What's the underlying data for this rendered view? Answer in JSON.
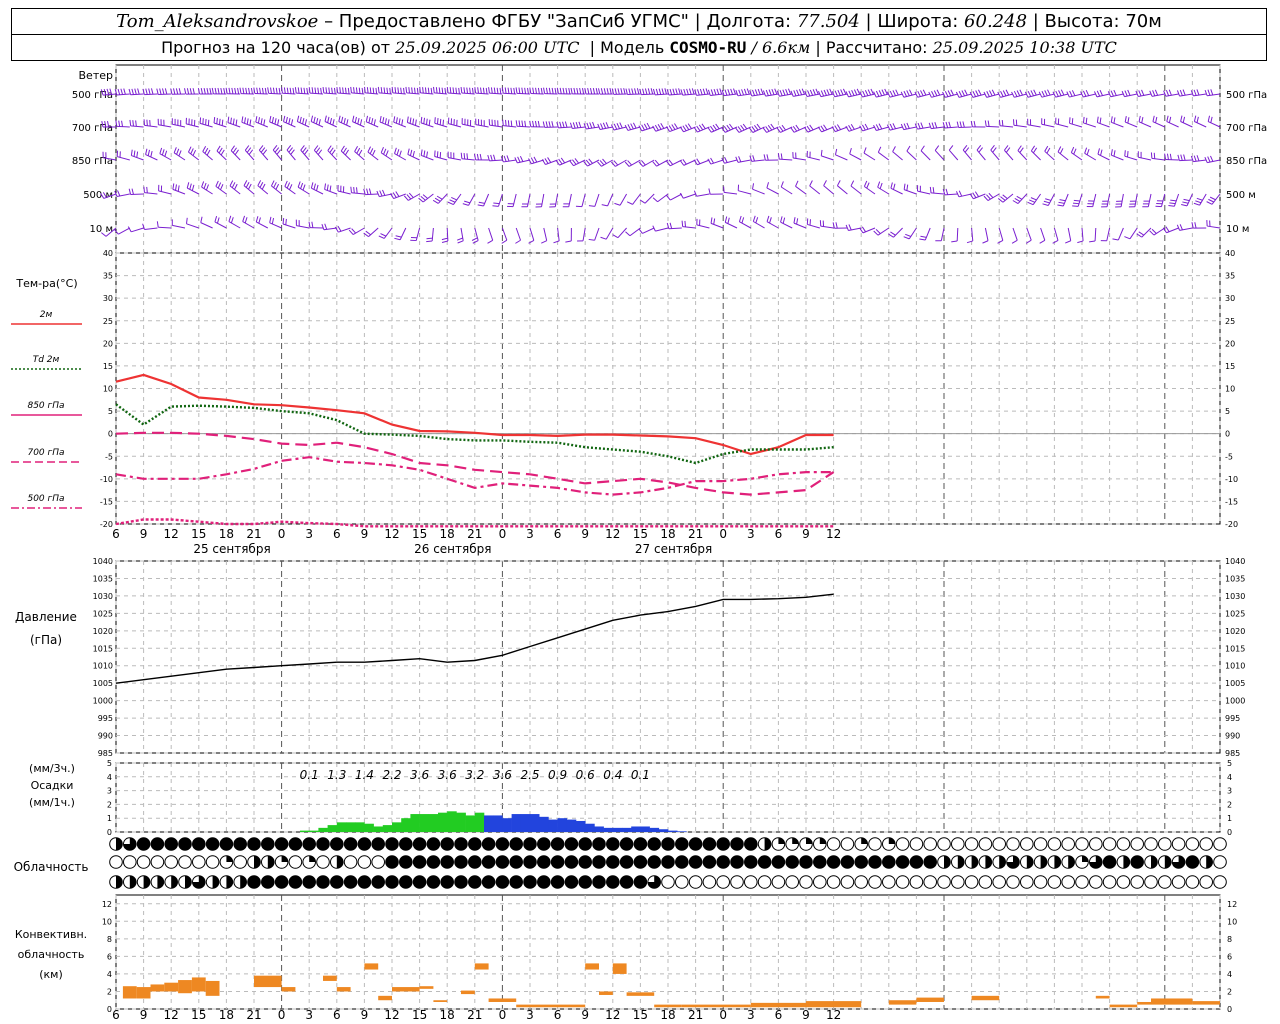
{
  "header": {
    "station": "Tom_Aleksandrovskoe",
    "provider": "– Предоставлено ФГБУ \"ЗапСиб УГМС\"",
    "lon_label": "Долгота:",
    "lon_value": "77.504",
    "lat_label": "Широта:",
    "lat_value": "60.248",
    "alt_label": "Высота:",
    "alt_value": "70м",
    "forecast_label": "Прогноз на 120 часа(ов) от",
    "forecast_start": "25.09.2025 06:00 UTC",
    "model_label": "Модель",
    "model_name": "COSMO-RU",
    "model_res": "/ 6.6км",
    "calc_label": "Рассчитано:",
    "calc_time": "25.09.2025 10:38 UTC"
  },
  "colors": {
    "wind": "#7a1fd0",
    "t2m": "#ee3333",
    "td2m": "#116611",
    "t850": "#e0207a",
    "t700": "#e0207a",
    "t500": "#e0207a",
    "pressure": "#000000",
    "precip_liquid": "#22cc22",
    "precip_snow": "#2244dd",
    "convective": "#ee8822"
  },
  "time_axis": {
    "hour_ticks": [
      "6",
      "9",
      "12",
      "15",
      "18",
      "21",
      "0",
      "3",
      "6",
      "9",
      "12",
      "15",
      "18",
      "21",
      "0",
      "3",
      "6",
      "9",
      "12",
      "15",
      "18",
      "21",
      "0",
      "3",
      "6",
      "9",
      "12"
    ],
    "date_labels": [
      "25 сентября",
      "26 сентября",
      "27 сентября"
    ]
  },
  "wind_panel": {
    "title": "Ветер",
    "levels": [
      "500 гПа",
      "700 гПа",
      "850 гПа",
      "500 м",
      "10 м"
    ]
  },
  "temp_panel": {
    "title": "Тем-ра(°С)",
    "legend": [
      {
        "label": "2м",
        "style": "solid"
      },
      {
        "label": "Td  2м",
        "style": "dotted"
      },
      {
        "label": "850 гПа",
        "style": "solid"
      },
      {
        "label": "700 гПа",
        "style": "dash"
      },
      {
        "label": "500 гПа",
        "style": "dashdot"
      }
    ],
    "ticks": [
      "40",
      "35",
      "30",
      "25",
      "20",
      "15",
      "10",
      "5",
      "0",
      "-5",
      "-10",
      "-15",
      "-20"
    ]
  },
  "pressure_panel": {
    "title": "Давление",
    "unit": "(гПа)",
    "ticks": [
      "1040",
      "1035",
      "1030",
      "1025",
      "1020",
      "1015",
      "1010",
      "1005",
      "1000",
      "995",
      "990",
      "985"
    ]
  },
  "precip_panel": {
    "unit3h": "(мм/3ч.)",
    "title": "Осадки",
    "unit1h": "(мм/1ч.)",
    "ticks": [
      "5",
      "4",
      "3",
      "2",
      "1",
      "0"
    ],
    "totals": [
      "0.1",
      "1.3",
      "1.4",
      "2.2",
      "3.6",
      "3.6",
      "3.2",
      "3.6",
      "2.5",
      "0.9",
      "0.6",
      "0.4",
      "0.1"
    ]
  },
  "cloud_panel": {
    "title": "Облачность"
  },
  "conv_panel": {
    "title_line1": "Конвективн.",
    "title_line2": "облачность",
    "unit": "(км)",
    "ticks": [
      "12",
      "10",
      "8",
      "6",
      "4",
      "2",
      "0"
    ]
  },
  "chart_data": {
    "type": "line",
    "hours": [
      0,
      3,
      6,
      9,
      12,
      15,
      18,
      21,
      24,
      27,
      30,
      33,
      36,
      39,
      42,
      45,
      48,
      51,
      54,
      57,
      60,
      63,
      66,
      69,
      72,
      75,
      78
    ],
    "series": [
      {
        "name": "2м",
        "unit": "°C",
        "values": [
          11.5,
          13,
          11,
          8,
          7.5,
          6.5,
          6.3,
          5.8,
          5.2,
          4.5,
          2,
          0.6,
          0.5,
          0.2,
          -0.3,
          -0.3,
          -0.5,
          -0.2,
          -0.2,
          -0.4,
          -0.6,
          -1,
          -2.5,
          -4.5,
          -3,
          -0.3,
          -0.3
        ]
      },
      {
        "name": "Td  2м",
        "unit": "°C",
        "values": [
          6.5,
          2,
          6,
          6.2,
          6,
          5.7,
          5,
          4.5,
          3,
          0,
          -0.2,
          -0.5,
          -1.2,
          -1.5,
          -1.5,
          -1.8,
          -2,
          -3,
          -3.5,
          -4,
          -5,
          -6.5,
          -4.5,
          -3.5,
          -3.5,
          -3.5,
          -3
        ]
      },
      {
        "name": "850 гПа",
        "unit": "°C",
        "values": [
          0,
          0.2,
          0.2,
          0,
          -0.5,
          -1.2,
          -2.2,
          -2.5,
          -2,
          -3,
          -4.5,
          -6.5,
          -7,
          -8,
          -8.5,
          -9,
          -10,
          -11,
          -10.5,
          -10,
          -10.8,
          -12,
          -13,
          -13.5,
          -13,
          -12.5,
          -8.5
        ]
      },
      {
        "name": "700 гПа",
        "unit": "°C",
        "values": [
          -9,
          -10,
          -10,
          -10,
          -9,
          -7.8,
          -6,
          -5.2,
          -6.2,
          -6.5,
          -7,
          -8,
          -10,
          -12,
          -11,
          -11.5,
          -12,
          -13,
          -13.5,
          -13,
          -12,
          -10.5,
          -10.5,
          -10,
          -9,
          -8.5,
          -8.5
        ]
      },
      {
        "name": "500 гПа",
        "unit": "°C",
        "values": [
          -20,
          -19,
          -19,
          -19.5,
          -20,
          -20,
          -19.5,
          -19.8,
          -20,
          -20.5,
          -21,
          -21,
          -21,
          -21,
          -21,
          -21,
          -21,
          -21,
          -21,
          -21,
          -21,
          -21,
          -21,
          -21,
          -21,
          -21,
          -21
        ]
      },
      {
        "name": "Давление",
        "unit": "гПа",
        "values": [
          1005,
          1006,
          1007,
          1008,
          1009,
          1009.5,
          1010,
          1010.5,
          1011,
          1011,
          1011.5,
          1012,
          1011,
          1011.5,
          1013,
          1015.5,
          1018,
          1020.5,
          1023,
          1024.5,
          1025.5,
          1027,
          1029,
          1029,
          1029.2,
          1029.6,
          1030.5
        ]
      }
    ],
    "precip_hourly_liquid": [
      0,
      0,
      0,
      0,
      0,
      0,
      0,
      0,
      0,
      0,
      0,
      0,
      0,
      0,
      0,
      0,
      0,
      0,
      0,
      0,
      0.1,
      0.1,
      0.3,
      0.5,
      0.7,
      0.7,
      0.7,
      0.6,
      0.4,
      0.5,
      0.7,
      1.0,
      1.3,
      1.3,
      1.3,
      1.4,
      1.5,
      1.4,
      1.2,
      1.4
    ],
    "precip_hourly_snow": [
      1.2,
      1.2,
      1.0,
      1.3,
      1.3,
      1.3,
      1.1,
      0.9,
      1.0,
      0.9,
      0.8,
      0.6,
      0.4,
      0.3,
      0.3,
      0.3,
      0.4,
      0.4,
      0.3,
      0.2,
      0.1,
      0.05,
      0,
      0,
      0
    ],
    "cloud_low": [
      2,
      2,
      2,
      2,
      2,
      2,
      3,
      2,
      2,
      2,
      4,
      4,
      4,
      4,
      4,
      4,
      4,
      4,
      4,
      4,
      4,
      4,
      4,
      4,
      4,
      4,
      4,
      4,
      4,
      4,
      4,
      4,
      4,
      4,
      4,
      4,
      4,
      4,
      4,
      3,
      0,
      0,
      0,
      0,
      0,
      0,
      0,
      0,
      0,
      0,
      0,
      0,
      0,
      0,
      0,
      0,
      0,
      0,
      0,
      0,
      0,
      0,
      0,
      0,
      0,
      0,
      0,
      0,
      0,
      0,
      0,
      0,
      0,
      0,
      0,
      0,
      0,
      0,
      0,
      0,
      0
    ],
    "cloud_mid": [
      2,
      3,
      4,
      4,
      4,
      4,
      4,
      4,
      4,
      4,
      4,
      4,
      4,
      4,
      4,
      4,
      4,
      4,
      4,
      4,
      4,
      4,
      4,
      4,
      4,
      4,
      4,
      4,
      4,
      4,
      4,
      4,
      4,
      4,
      4,
      4,
      4,
      4,
      4,
      4,
      4,
      4,
      4,
      4,
      4,
      4,
      4,
      2,
      1,
      1,
      1,
      1,
      0,
      0,
      1,
      0,
      1,
      0,
      0,
      0,
      0,
      0,
      0,
      0,
      0,
      0,
      0,
      0,
      0,
      0,
      0,
      0,
      0,
      0,
      0,
      0,
      0,
      0,
      0,
      0,
      0,
      0
    ],
    "cloud_high": [
      0,
      0,
      0,
      0,
      0,
      0,
      0,
      0,
      1,
      0,
      2,
      2,
      1,
      0,
      1,
      0,
      2,
      0,
      0,
      0,
      4,
      4,
      4,
      4,
      4,
      4,
      4,
      4,
      4,
      4,
      4,
      4,
      4,
      4,
      4,
      4,
      4,
      4,
      4,
      4,
      4,
      4,
      4,
      4,
      4,
      4,
      4,
      4,
      4,
      4,
      4,
      4,
      4,
      4,
      4,
      4,
      4,
      4,
      4,
      4,
      2,
      2,
      2,
      2,
      2,
      3,
      2,
      2,
      2,
      2,
      1,
      3,
      4,
      2,
      4,
      2,
      2,
      3,
      4,
      2,
      0,
      0
    ],
    "convective_blocks": [
      {
        "start": 0.5,
        "end": 1.5,
        "bottom": 1.2,
        "top": 2.6
      },
      {
        "start": 1.5,
        "end": 2.5,
        "bottom": 1.2,
        "top": 2.5
      },
      {
        "start": 2.5,
        "end": 3.5,
        "bottom": 2.0,
        "top": 2.8
      },
      {
        "start": 3.5,
        "end": 4.5,
        "bottom": 2.0,
        "top": 3.0
      },
      {
        "start": 4.5,
        "end": 5.5,
        "bottom": 1.8,
        "top": 3.3
      },
      {
        "start": 5.5,
        "end": 6.5,
        "bottom": 2.0,
        "top": 3.6
      },
      {
        "start": 6.5,
        "end": 7.5,
        "bottom": 1.5,
        "top": 3.2
      },
      {
        "start": 10,
        "end": 12,
        "bottom": 2.5,
        "top": 3.8
      },
      {
        "start": 12,
        "end": 13,
        "bottom": 2.0,
        "top": 2.5
      },
      {
        "start": 15,
        "end": 16,
        "bottom": 3.2,
        "top": 3.8
      },
      {
        "start": 16,
        "end": 17,
        "bottom": 2.0,
        "top": 2.5
      },
      {
        "start": 18,
        "end": 19,
        "bottom": 4.5,
        "top": 5.2
      },
      {
        "start": 19,
        "end": 20,
        "bottom": 1.0,
        "top": 1.5
      },
      {
        "start": 20,
        "end": 22,
        "bottom": 2.0,
        "top": 2.5
      },
      {
        "start": 22,
        "end": 23,
        "bottom": 2.3,
        "top": 2.6
      },
      {
        "start": 23,
        "end": 24,
        "bottom": 0.8,
        "top": 1.0
      },
      {
        "start": 25,
        "end": 26,
        "bottom": 1.7,
        "top": 2.1
      },
      {
        "start": 26,
        "end": 27,
        "bottom": 4.5,
        "top": 5.2
      },
      {
        "start": 27,
        "end": 29,
        "bottom": 0.8,
        "top": 1.2
      },
      {
        "start": 29,
        "end": 34,
        "bottom": 0.2,
        "top": 0.5
      },
      {
        "start": 34,
        "end": 35,
        "bottom": 4.5,
        "top": 5.2
      },
      {
        "start": 35,
        "end": 36,
        "bottom": 1.6,
        "top": 2.0
      },
      {
        "start": 36,
        "end": 37,
        "bottom": 4.0,
        "top": 5.2
      },
      {
        "start": 37,
        "end": 39,
        "bottom": 1.5,
        "top": 1.9
      },
      {
        "start": 39,
        "end": 41,
        "bottom": 0.2,
        "top": 0.5
      },
      {
        "start": 41,
        "end": 46,
        "bottom": 0.2,
        "top": 0.5
      },
      {
        "start": 46,
        "end": 50,
        "bottom": 0.2,
        "top": 0.7
      },
      {
        "start": 50,
        "end": 54,
        "bottom": 0.2,
        "top": 0.9
      },
      {
        "start": 56,
        "end": 58,
        "bottom": 0.5,
        "top": 1.0
      },
      {
        "start": 58,
        "end": 60,
        "bottom": 0.8,
        "top": 1.3
      },
      {
        "start": 62,
        "end": 64,
        "bottom": 1.0,
        "top": 1.5
      },
      {
        "start": 71,
        "end": 72,
        "bottom": 1.2,
        "top": 1.5
      },
      {
        "start": 72,
        "end": 74,
        "bottom": 0.2,
        "top": 0.5
      },
      {
        "start": 74,
        "end": 75,
        "bottom": 0.5,
        "top": 0.8
      },
      {
        "start": 75,
        "end": 78,
        "bottom": 0.5,
        "top": 1.2
      },
      {
        "start": 78,
        "end": 80,
        "bottom": 0.5,
        "top": 0.9
      }
    ]
  }
}
